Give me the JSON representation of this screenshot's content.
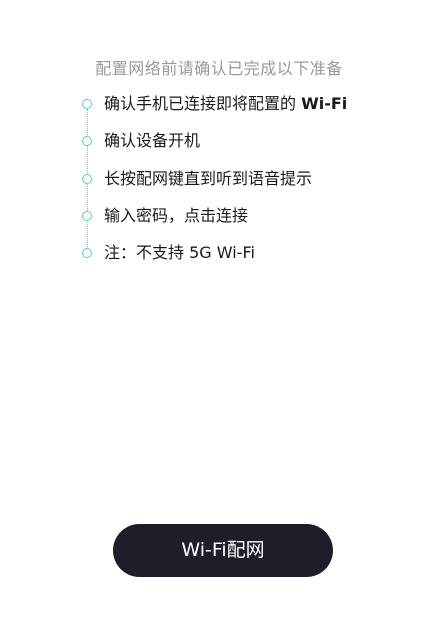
{
  "header": {
    "instruction": "配置网络前请确认已完成以下准备"
  },
  "steps": [
    {
      "label": "确认手机已连接即将配置的 ",
      "label_bold": "Wi-Fi"
    },
    {
      "label": "确认设备开机"
    },
    {
      "label": "长按配网键直到听到语音提示"
    },
    {
      "label": "输入密码，点击连接"
    },
    {
      "label": "注：不支持 5G Wi-Fi"
    }
  ],
  "button": {
    "label": "Wi-Fi配网"
  },
  "colors": {
    "accent": "#4fd1c0",
    "button_bg": "#1e1e2a"
  }
}
